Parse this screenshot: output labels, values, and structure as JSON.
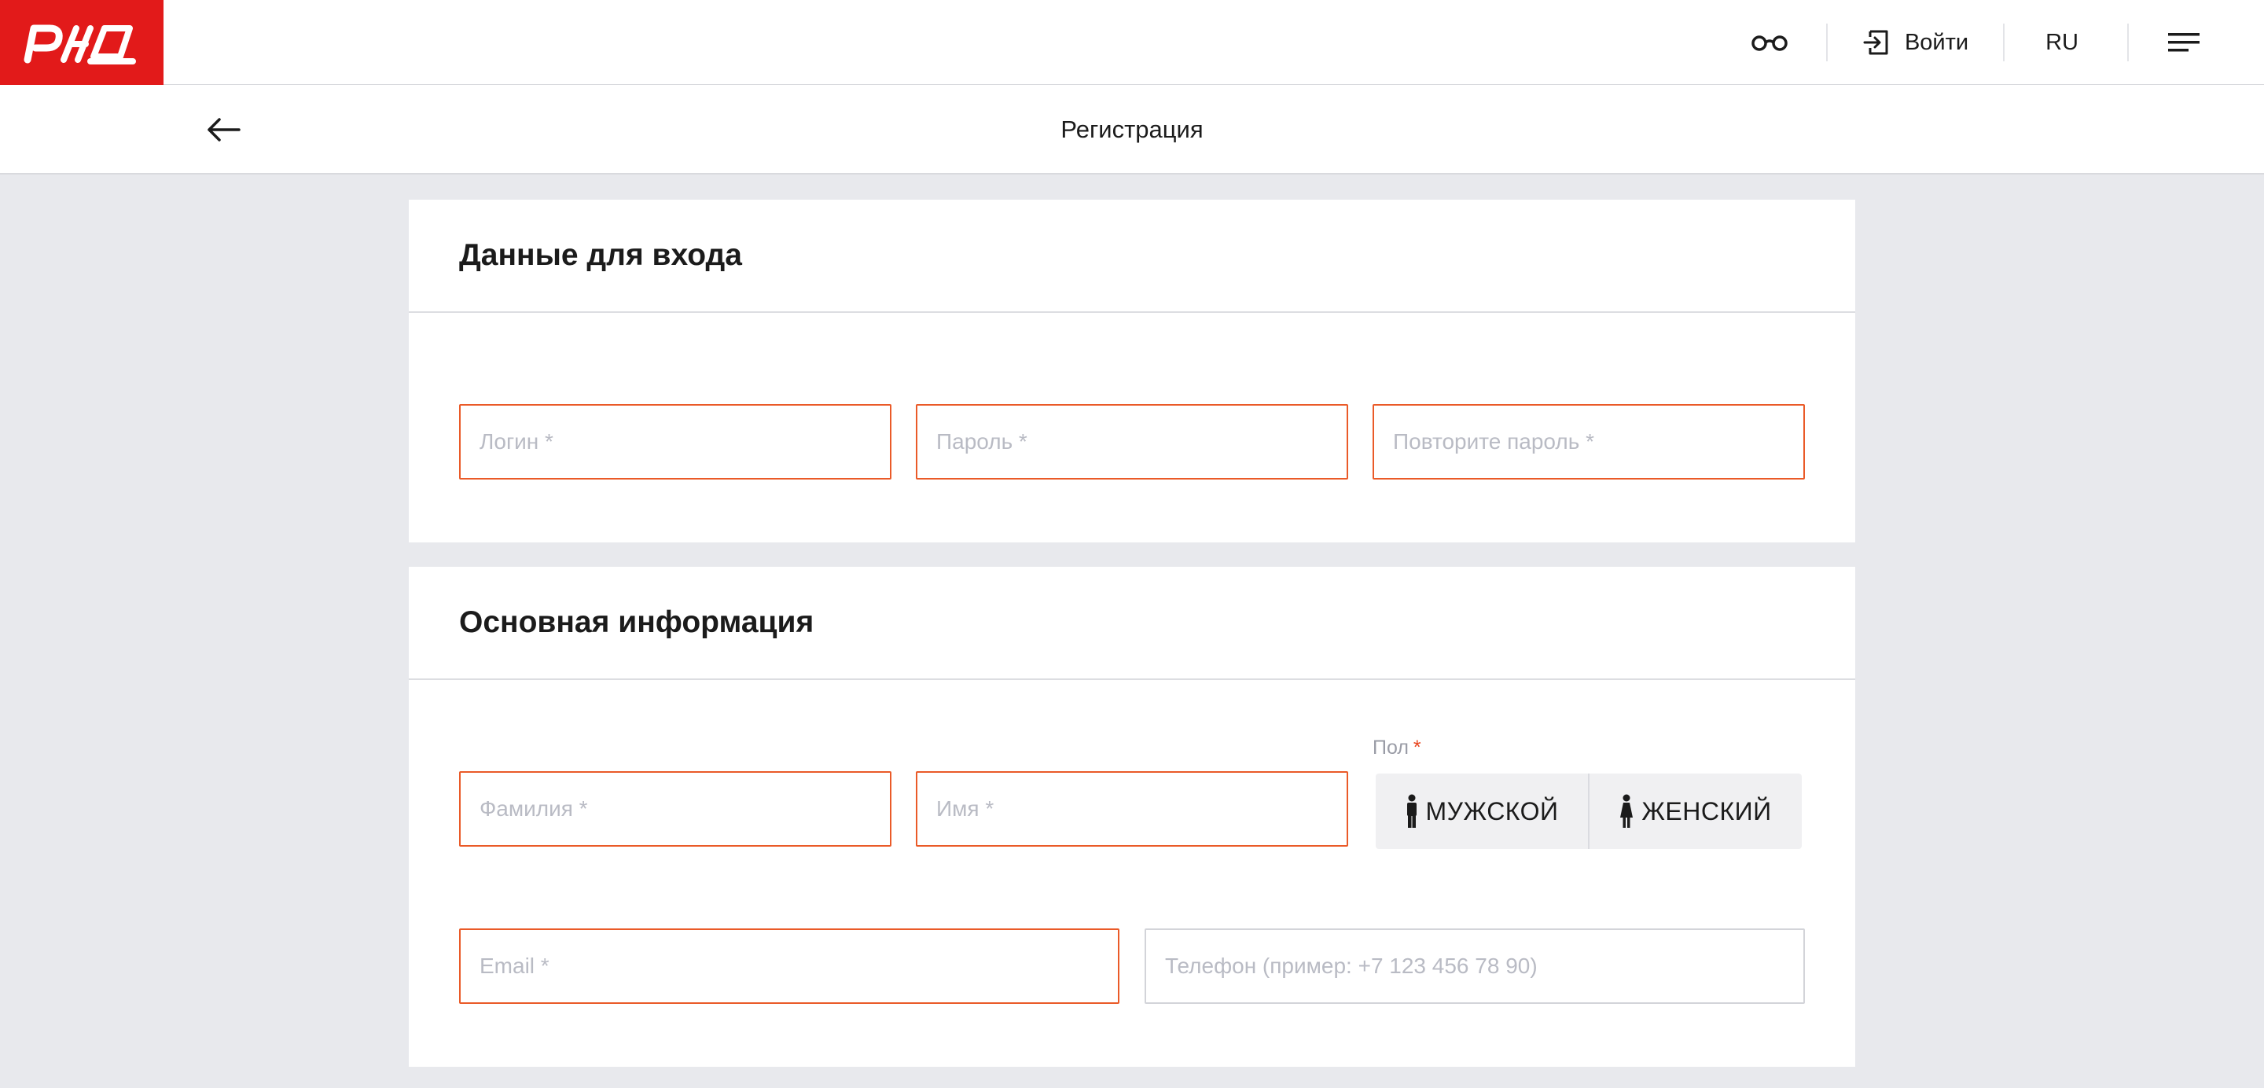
{
  "header": {
    "logo_alt": "РЖД",
    "login_label": "Войти",
    "language": "RU"
  },
  "subheader": {
    "title": "Регистрация"
  },
  "login_section": {
    "title": "Данные для входа",
    "login_placeholder": "Логин *",
    "password_placeholder": "Пароль *",
    "repeat_password_placeholder": "Повторите пароль *"
  },
  "basic_section": {
    "title": "Основная информация",
    "surname_placeholder": "Фамилия *",
    "name_placeholder": "Имя *",
    "gender_label": "Пол",
    "gender_required": "*",
    "gender_options": [
      "МУЖСКОЙ",
      "ЖЕНСКИЙ"
    ],
    "email_placeholder": "Email *",
    "phone_placeholder": "Телефон (пример: +7 123 456 78 90)"
  },
  "colors": {
    "brand_red": "#e21a1a",
    "field_error_border": "#ea5a28",
    "page_background": "#e8e9ed"
  },
  "icons": {
    "accessibility": "glasses-icon",
    "login": "sign-in-icon",
    "menu": "menu-icon",
    "back": "arrow-left-icon",
    "male": "male-figure-icon",
    "female": "female-figure-icon"
  }
}
